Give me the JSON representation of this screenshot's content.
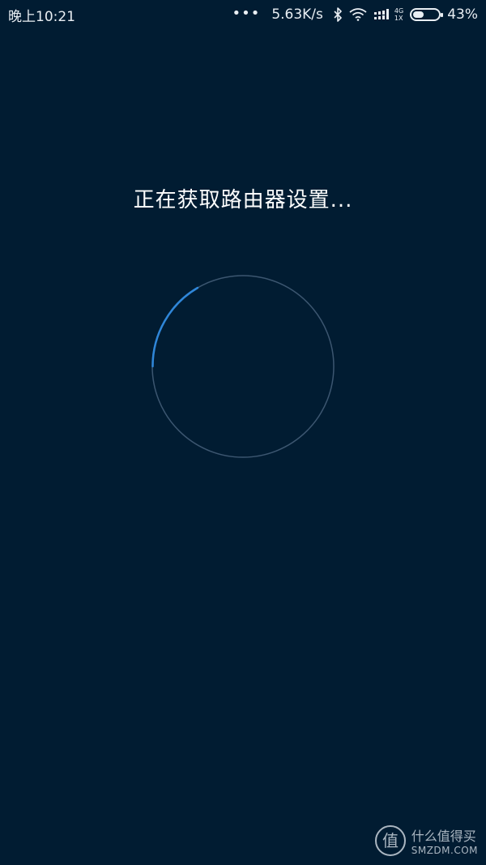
{
  "status_bar": {
    "time": "晚上10:21",
    "dots": "•••",
    "speed": "5.63K/s",
    "network_top": "4G",
    "network_bottom": "1X",
    "battery_percent": "43%",
    "battery_level": 0.43,
    "icons": [
      "bluetooth-icon",
      "wifi-icon",
      "signal-icon",
      "battery-icon"
    ]
  },
  "main": {
    "loading_text": "正在获取路由器设置...",
    "spinner": {
      "ring_color": "#3c5670",
      "arc_color": "#2f86d8"
    }
  },
  "watermark": {
    "logo_char": "值",
    "title": "什么值得买",
    "site": "SMZDM.COM"
  },
  "colors": {
    "background": "#011c32",
    "text": "#ffffff"
  }
}
